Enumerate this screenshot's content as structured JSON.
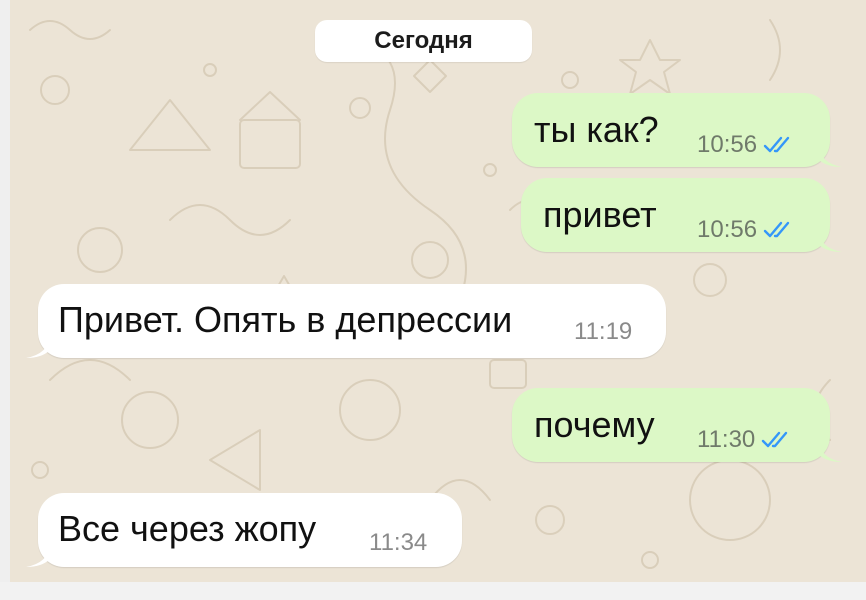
{
  "chat": {
    "date_label": "Сегодня",
    "messages": [
      {
        "direction": "out",
        "text": "ты как?",
        "time": "10:56",
        "read": true
      },
      {
        "direction": "out",
        "text": "привет",
        "time": "10:56",
        "read": true
      },
      {
        "direction": "in",
        "text": "Привет. Опять в депрессии",
        "time": "11:19"
      },
      {
        "direction": "out",
        "text": "почему",
        "time": "11:30",
        "read": true
      },
      {
        "direction": "in",
        "text": "Все через жопу",
        "time": "11:34"
      }
    ]
  },
  "colors": {
    "outgoing_bubble": "#dcf8c6",
    "incoming_bubble": "#ffffff",
    "chat_background": "#ece4d6",
    "read_check": "#3497f9"
  },
  "icons": {
    "read_receipt": "double-check-icon"
  }
}
